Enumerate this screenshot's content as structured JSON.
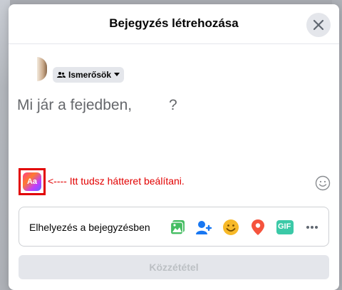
{
  "dialog": {
    "title": "Bejegyzés létrehozása",
    "audience_label": "Ismerősök",
    "composer_placeholder": "Mi jár a fejedben,",
    "composer_question_mark": "?",
    "annotation": "<---- Itt tudsz hátteret beálítani.",
    "background_button_text": "Aa",
    "add_to_post_label": "Elhelyezés a bejegyzésben",
    "add_to_post_icons": [
      "photo-video-icon",
      "tag-people-icon",
      "feeling-icon",
      "check-in-icon",
      "gif-icon",
      "more-icon"
    ],
    "gif_text": "GIF",
    "post_button": "Közzététel"
  },
  "colors": {
    "annotation": "#e20000",
    "photo": "#45bd62",
    "tag": "#1877f2",
    "feeling": "#f7b928",
    "checkin": "#f5533d",
    "gif": "#3bc9a7"
  }
}
